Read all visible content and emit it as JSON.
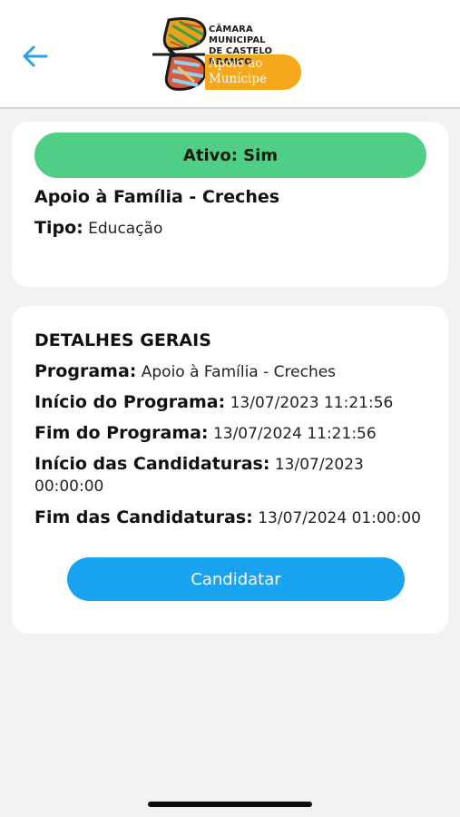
{
  "header": {
    "back_icon": "arrow-left-icon",
    "logo_org": "CÂMARA MUNICIPAL\nDE CASTELO BRANCO",
    "logo_app": "Apoio ao\nMunícipe",
    "colors": {
      "back_arrow": "#2ea0e6",
      "logo_pill": "#f5a81c"
    }
  },
  "summary": {
    "status": "Ativo: Sim",
    "title": "Apoio à Família - Creches",
    "tipo_label": "Tipo:",
    "tipo_value": "Educação",
    "colors": {
      "status_pill": "#4fcf86"
    }
  },
  "details": {
    "heading": "DETALHES GERAIS",
    "rows": [
      {
        "label": "Programa:",
        "value": "Apoio à Família - Creches"
      },
      {
        "label": "Início do Programa:",
        "value": "13/07/2023 11:21:56"
      },
      {
        "label": "Fim do Programa:",
        "value": "13/07/2024 11:21:56"
      },
      {
        "label": "Início das Candidaturas:",
        "value": "13/07/2023 00:00:00"
      },
      {
        "label": "Fim das Candidaturas:",
        "value": "13/07/2024 01:00:00"
      }
    ],
    "apply_label": "Candidatar",
    "colors": {
      "apply_button": "#1aa3f0"
    }
  }
}
